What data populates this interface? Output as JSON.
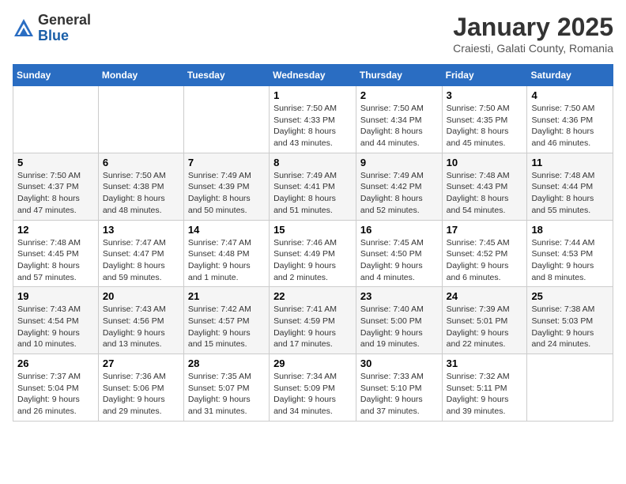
{
  "header": {
    "logo_general": "General",
    "logo_blue": "Blue",
    "month_title": "January 2025",
    "location": "Craiesti, Galati County, Romania"
  },
  "days_of_week": [
    "Sunday",
    "Monday",
    "Tuesday",
    "Wednesday",
    "Thursday",
    "Friday",
    "Saturday"
  ],
  "weeks": [
    [
      {
        "day": "",
        "info": ""
      },
      {
        "day": "",
        "info": ""
      },
      {
        "day": "",
        "info": ""
      },
      {
        "day": "1",
        "info": "Sunrise: 7:50 AM\nSunset: 4:33 PM\nDaylight: 8 hours and 43 minutes."
      },
      {
        "day": "2",
        "info": "Sunrise: 7:50 AM\nSunset: 4:34 PM\nDaylight: 8 hours and 44 minutes."
      },
      {
        "day": "3",
        "info": "Sunrise: 7:50 AM\nSunset: 4:35 PM\nDaylight: 8 hours and 45 minutes."
      },
      {
        "day": "4",
        "info": "Sunrise: 7:50 AM\nSunset: 4:36 PM\nDaylight: 8 hours and 46 minutes."
      }
    ],
    [
      {
        "day": "5",
        "info": "Sunrise: 7:50 AM\nSunset: 4:37 PM\nDaylight: 8 hours and 47 minutes."
      },
      {
        "day": "6",
        "info": "Sunrise: 7:50 AM\nSunset: 4:38 PM\nDaylight: 8 hours and 48 minutes."
      },
      {
        "day": "7",
        "info": "Sunrise: 7:49 AM\nSunset: 4:39 PM\nDaylight: 8 hours and 50 minutes."
      },
      {
        "day": "8",
        "info": "Sunrise: 7:49 AM\nSunset: 4:41 PM\nDaylight: 8 hours and 51 minutes."
      },
      {
        "day": "9",
        "info": "Sunrise: 7:49 AM\nSunset: 4:42 PM\nDaylight: 8 hours and 52 minutes."
      },
      {
        "day": "10",
        "info": "Sunrise: 7:48 AM\nSunset: 4:43 PM\nDaylight: 8 hours and 54 minutes."
      },
      {
        "day": "11",
        "info": "Sunrise: 7:48 AM\nSunset: 4:44 PM\nDaylight: 8 hours and 55 minutes."
      }
    ],
    [
      {
        "day": "12",
        "info": "Sunrise: 7:48 AM\nSunset: 4:45 PM\nDaylight: 8 hours and 57 minutes."
      },
      {
        "day": "13",
        "info": "Sunrise: 7:47 AM\nSunset: 4:47 PM\nDaylight: 8 hours and 59 minutes."
      },
      {
        "day": "14",
        "info": "Sunrise: 7:47 AM\nSunset: 4:48 PM\nDaylight: 9 hours and 1 minute."
      },
      {
        "day": "15",
        "info": "Sunrise: 7:46 AM\nSunset: 4:49 PM\nDaylight: 9 hours and 2 minutes."
      },
      {
        "day": "16",
        "info": "Sunrise: 7:45 AM\nSunset: 4:50 PM\nDaylight: 9 hours and 4 minutes."
      },
      {
        "day": "17",
        "info": "Sunrise: 7:45 AM\nSunset: 4:52 PM\nDaylight: 9 hours and 6 minutes."
      },
      {
        "day": "18",
        "info": "Sunrise: 7:44 AM\nSunset: 4:53 PM\nDaylight: 9 hours and 8 minutes."
      }
    ],
    [
      {
        "day": "19",
        "info": "Sunrise: 7:43 AM\nSunset: 4:54 PM\nDaylight: 9 hours and 10 minutes."
      },
      {
        "day": "20",
        "info": "Sunrise: 7:43 AM\nSunset: 4:56 PM\nDaylight: 9 hours and 13 minutes."
      },
      {
        "day": "21",
        "info": "Sunrise: 7:42 AM\nSunset: 4:57 PM\nDaylight: 9 hours and 15 minutes."
      },
      {
        "day": "22",
        "info": "Sunrise: 7:41 AM\nSunset: 4:59 PM\nDaylight: 9 hours and 17 minutes."
      },
      {
        "day": "23",
        "info": "Sunrise: 7:40 AM\nSunset: 5:00 PM\nDaylight: 9 hours and 19 minutes."
      },
      {
        "day": "24",
        "info": "Sunrise: 7:39 AM\nSunset: 5:01 PM\nDaylight: 9 hours and 22 minutes."
      },
      {
        "day": "25",
        "info": "Sunrise: 7:38 AM\nSunset: 5:03 PM\nDaylight: 9 hours and 24 minutes."
      }
    ],
    [
      {
        "day": "26",
        "info": "Sunrise: 7:37 AM\nSunset: 5:04 PM\nDaylight: 9 hours and 26 minutes."
      },
      {
        "day": "27",
        "info": "Sunrise: 7:36 AM\nSunset: 5:06 PM\nDaylight: 9 hours and 29 minutes."
      },
      {
        "day": "28",
        "info": "Sunrise: 7:35 AM\nSunset: 5:07 PM\nDaylight: 9 hours and 31 minutes."
      },
      {
        "day": "29",
        "info": "Sunrise: 7:34 AM\nSunset: 5:09 PM\nDaylight: 9 hours and 34 minutes."
      },
      {
        "day": "30",
        "info": "Sunrise: 7:33 AM\nSunset: 5:10 PM\nDaylight: 9 hours and 37 minutes."
      },
      {
        "day": "31",
        "info": "Sunrise: 7:32 AM\nSunset: 5:11 PM\nDaylight: 9 hours and 39 minutes."
      },
      {
        "day": "",
        "info": ""
      }
    ]
  ]
}
